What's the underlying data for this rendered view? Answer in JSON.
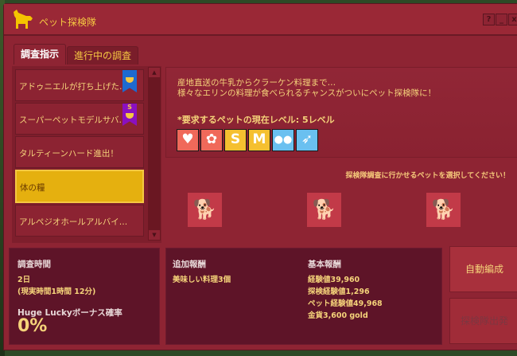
{
  "window": {
    "title": "ペット探検隊",
    "help": "?",
    "minimize": "_",
    "close": "x"
  },
  "tabs": [
    {
      "label": "調査指示",
      "active": true
    },
    {
      "label": "進行中の調査",
      "active": false
    }
  ],
  "quests": [
    {
      "label": "アドゥニエルが打ち上げた…",
      "badge": "blue"
    },
    {
      "label": "スーパーペットモデルサバ…",
      "badge": "purple-S",
      "badge_text": "S"
    },
    {
      "label": "タルティーンハード進出！"
    },
    {
      "label": "体の糧",
      "selected": true
    },
    {
      "label": "アルペジオホールアルバイ…"
    }
  ],
  "detail": {
    "description": [
      "産地直送の牛乳からクラーケン料理まで…",
      "様々なエリンの料理が食べられるチャンスがついにペット探検隊に！"
    ],
    "requirement": "*要求するペットの現在レベル: 5レベル",
    "trait_icons": [
      {
        "name": "heart-icon",
        "glyph": "♥",
        "color": "#f0695a"
      },
      {
        "name": "gear-icon",
        "glyph": "✿",
        "color": "#f0695a"
      },
      {
        "name": "s-size-icon",
        "glyph": "S",
        "color": "#f5c030"
      },
      {
        "name": "m-size-icon",
        "glyph": "M",
        "color": "#f5c030"
      },
      {
        "name": "paw-icon",
        "glyph": "🐾",
        "color": "#6ac0f0"
      },
      {
        "name": "wing-icon",
        "glyph": "➶",
        "color": "#6ac0f0"
      }
    ],
    "select_hint": "探検隊調査に行かせるペットを選択してください！"
  },
  "time": {
    "label": "調査時間",
    "days": "2日",
    "real": "(現実時間1時間 12分)",
    "bonus_label": "Huge Luckyボーナス確率",
    "bonus": "0%"
  },
  "extra_reward": {
    "label": "追加報酬",
    "items": [
      "美味しい料理3個"
    ]
  },
  "base_reward": {
    "label": "基本報酬",
    "items": [
      "経験値39,960",
      "探検経験値1,296",
      "ペット経験値49,968",
      "金貨3,600 gold"
    ]
  },
  "buttons": {
    "auto": "自動編成",
    "depart": "探検隊出発"
  }
}
